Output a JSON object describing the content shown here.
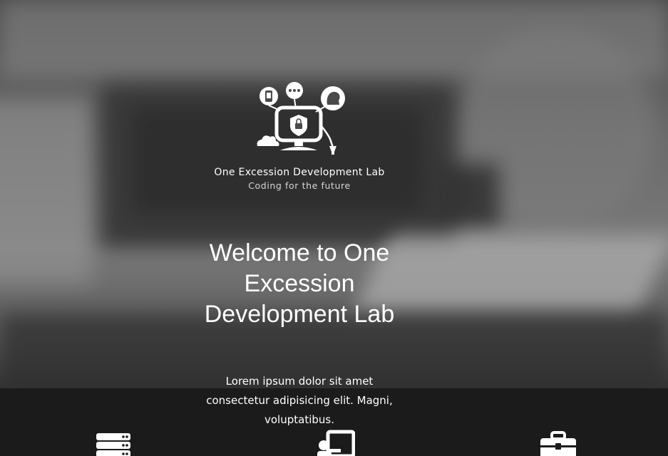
{
  "brand": {
    "name": "One Excession Development Lab",
    "tagline": "Coding for the future"
  },
  "hero": {
    "heading": "Welcome to One Excession Development Lab",
    "lead": "Lorem ipsum dolor sit amet consectetur adipisicing elit. Magni, voluptatibus."
  },
  "icons": {
    "logo": "computer-lock-logo",
    "features": [
      "server-icon",
      "presenter-board-icon",
      "briefcase-icon"
    ]
  },
  "colors": {
    "text": "#ffffff",
    "bottom_band": "#1b1b1b"
  }
}
